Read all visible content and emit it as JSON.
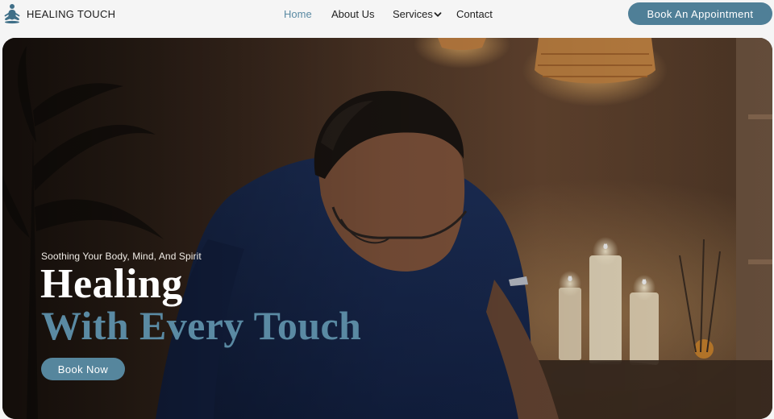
{
  "brand": {
    "name": "HEALING TOUCH",
    "logo_icon": "meditation-figure-icon"
  },
  "nav": {
    "items": [
      {
        "label": "Home",
        "active": true
      },
      {
        "label": "About Us",
        "active": false
      },
      {
        "label": "Services",
        "active": false,
        "has_dropdown": true
      },
      {
        "label": "Contact",
        "active": false
      }
    ]
  },
  "header": {
    "cta_label": "Book An Appointment"
  },
  "hero": {
    "subtitle": "Soothing Your Body, Mind, And Spirit",
    "title_line1": "Healing",
    "title_line2": "With Every Touch",
    "cta_label": "Book Now",
    "background": "massage-therapist-photo"
  },
  "colors": {
    "accent": "#4f7f97",
    "accent_text": "#5a8aa3",
    "header_bg": "#f5f5f5"
  }
}
